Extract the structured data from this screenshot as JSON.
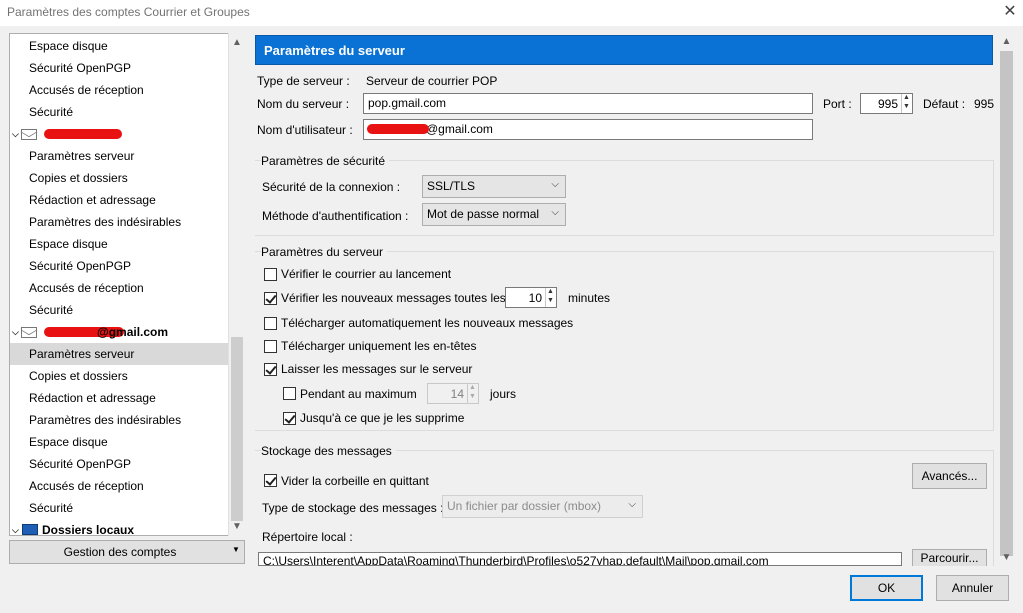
{
  "window": {
    "title": "Paramètres des comptes Courrier et Groupes",
    "close_glyph": "✕"
  },
  "tree": {
    "items": [
      {
        "kind": "item",
        "label": "Espace disque"
      },
      {
        "kind": "item",
        "label": "Sécurité OpenPGP"
      },
      {
        "kind": "item",
        "label": "Accusés de réception"
      },
      {
        "kind": "item",
        "label": "Sécurité"
      },
      {
        "kind": "account",
        "label": ""
      },
      {
        "kind": "item",
        "label": "Paramètres serveur"
      },
      {
        "kind": "item",
        "label": "Copies et dossiers"
      },
      {
        "kind": "item",
        "label": "Rédaction et adressage"
      },
      {
        "kind": "item",
        "label": "Paramètres des indésirables"
      },
      {
        "kind": "item",
        "label": "Espace disque"
      },
      {
        "kind": "item",
        "label": "Sécurité OpenPGP"
      },
      {
        "kind": "item",
        "label": "Accusés de réception"
      },
      {
        "kind": "item",
        "label": "Sécurité"
      },
      {
        "kind": "account",
        "label": "@gmail.com"
      },
      {
        "kind": "item",
        "label": "Paramètres serveur",
        "selected": true
      },
      {
        "kind": "item",
        "label": "Copies et dossiers"
      },
      {
        "kind": "item",
        "label": "Rédaction et adressage"
      },
      {
        "kind": "item",
        "label": "Paramètres des indésirables"
      },
      {
        "kind": "item",
        "label": "Espace disque"
      },
      {
        "kind": "item",
        "label": "Sécurité OpenPGP"
      },
      {
        "kind": "item",
        "label": "Accusés de réception"
      },
      {
        "kind": "item",
        "label": "Sécurité"
      },
      {
        "kind": "local",
        "label": "Dossiers locaux"
      }
    ],
    "manage_button": "Gestion des comptes"
  },
  "server": {
    "header": "Paramètres du serveur",
    "server_type_label": "Type de serveur :",
    "server_type_value": "Serveur de courrier POP",
    "server_name_label": "Nom du serveur :",
    "server_name_value": "pop.gmail.com",
    "port_label": "Port :",
    "port_value": "995",
    "default_label": "Défaut :",
    "default_value": "995",
    "username_label": "Nom d'utilisateur :",
    "username_value": "@gmail.com"
  },
  "security": {
    "title": "Paramètres de sécurité",
    "connection_label": "Sécurité de la connexion :",
    "connection_value": "SSL/TLS",
    "auth_label": "Méthode d'authentification :",
    "auth_value": "Mot de passe normal"
  },
  "server_settings": {
    "title": "Paramètres du serveur",
    "check_on_startup": {
      "label": "Vérifier le courrier au lancement",
      "checked": false
    },
    "check_every": {
      "label": "Vérifier les nouveaux messages toutes les",
      "checked": true,
      "value": "10",
      "unit": "minutes"
    },
    "auto_download": {
      "label": "Télécharger automatiquement les nouveaux messages",
      "checked": false
    },
    "headers_only": {
      "label": "Télécharger uniquement les en-têtes",
      "checked": false
    },
    "leave_on_server": {
      "label": "Laisser les messages sur le serveur",
      "checked": true
    },
    "max_days": {
      "label": "Pendant au maximum",
      "checked": false,
      "value": "14",
      "unit": "jours"
    },
    "until_deleted": {
      "label": "Jusqu'à ce que je les supprime",
      "checked": true
    }
  },
  "storage": {
    "title": "Stockage des messages",
    "empty_trash": {
      "label": "Vider la corbeille en quittant",
      "checked": true
    },
    "advanced_button": "Avancés...",
    "storage_type_label": "Type de stockage des messages :",
    "storage_type_value": "Un fichier par dossier (mbox)",
    "local_dir_label": "Répertoire local :",
    "local_dir_value": "C:\\Users\\Interent\\AppData\\Roaming\\Thunderbird\\Profiles\\o527yhap.default\\Mail\\pop.gmail.com",
    "browse_button": "Parcourir..."
  },
  "footer": {
    "ok": "OK",
    "cancel": "Annuler"
  },
  "colors": {
    "header": "#0a72d4",
    "redaction": "#e81212",
    "selection": "#d9d9d9"
  },
  "icons": {
    "account": "envelope-icon",
    "local": "monitor-icon"
  }
}
